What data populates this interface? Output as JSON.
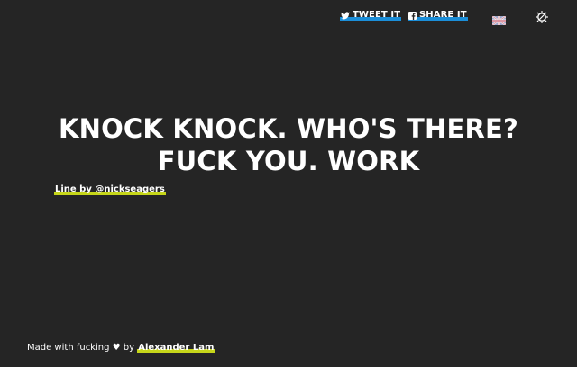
{
  "header": {
    "tweet_label": "TWEET IT",
    "share_label": "SHARE IT",
    "tweet_icon": "twitter-bird-icon",
    "share_icon": "facebook-icon",
    "flag_icon": "uk-flag-icon",
    "theme_icon": "theme-toggle-icon"
  },
  "message": {
    "line1": "KNOCK KNOCK. WHO'S THERE?",
    "line2": "FUCK YOU. WORK"
  },
  "credit": {
    "text": "Line by @nickseagers"
  },
  "footer": {
    "prefix": "Made with fucking ♥ by ",
    "author": "Alexander Lam"
  },
  "colors": {
    "background": "#252525",
    "text": "#ffffff",
    "share_underline": "#1b8ed8",
    "link_underline": "#c6d61a"
  }
}
